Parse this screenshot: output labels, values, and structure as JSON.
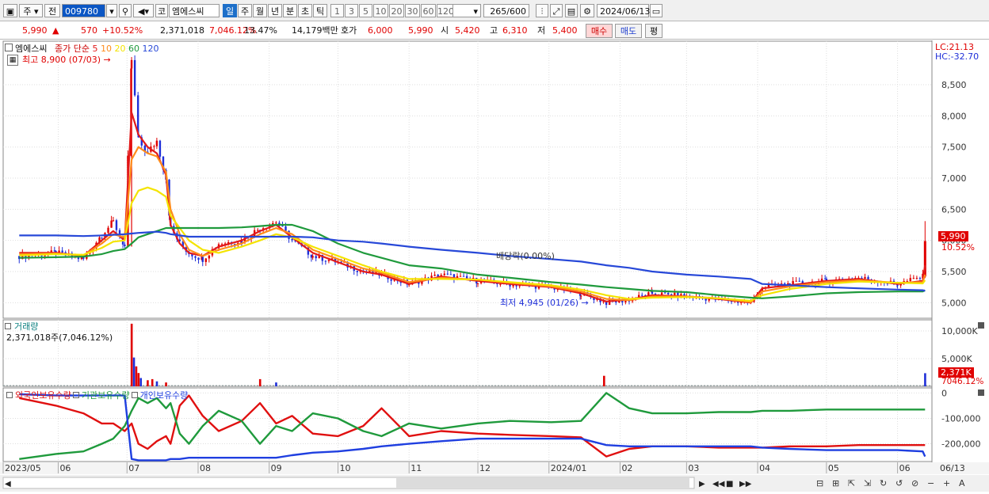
{
  "toolbar": {
    "market": "주",
    "code_type": "전",
    "code": "009780",
    "name_prefix": "코",
    "name": "엠에스씨",
    "periods": [
      "일",
      "주",
      "월",
      "년",
      "분",
      "초",
      "틱"
    ],
    "intervals": [
      "1",
      "3",
      "5",
      "10",
      "20",
      "30",
      "60",
      "120"
    ],
    "count": "265",
    "count_max": "/600",
    "date": "2024/06/13"
  },
  "quote": {
    "price": "5,990",
    "direction": "▲",
    "change": "570",
    "change_pct": "+10.52%",
    "volume": "2,371,018",
    "volume_pct": "7,046.12%",
    "turnover": "13.47%",
    "amount": "14,179백만",
    "bid_label": "호가",
    "bid1": "6,000",
    "bid2": "5,990",
    "open_label": "시",
    "open": "5,420",
    "high_label": "고",
    "high": "6,310",
    "low_label": "저",
    "low": "5,400",
    "buy": "매수",
    "sell": "매도",
    "eval": "평"
  },
  "price_panel": {
    "title": "엠에스씨",
    "ma_label": "종가 단순",
    "ma_periods": [
      "5",
      "10",
      "20",
      "60",
      "120"
    ],
    "ma_colors": [
      "#e21a1a",
      "#ff8c1a",
      "#f4e400",
      "#1f9a3c",
      "#2748d8"
    ],
    "high_note": "최고 8,900 (07/03)",
    "low_note": "최저 4,945 (01/26)",
    "dividend_note": "배당락(0.00%)",
    "lc": "LC:21.13",
    "hc": "HC:-32.70",
    "last_price": "5,990",
    "last_pct": "10.52%"
  },
  "volume_panel": {
    "title": "거래량",
    "value_note": "2,371,018주(7,046.12%)",
    "last_value": "2,371K",
    "last_pct": "7046.12%"
  },
  "holding_panel": {
    "series": [
      "외국인보유수량",
      "기관보유수량",
      "개인보유수량"
    ],
    "colors": [
      "#e01010",
      "#1f9a3c",
      "#1f3fe0"
    ]
  },
  "colors": {
    "up": "#e00000",
    "down": "#1f2fd8",
    "grid": "#d8d8d8",
    "highlight": "#e00000"
  },
  "chart_data": [
    {
      "type": "candlestick",
      "title": "엠에스씨",
      "x_ticks": [
        "2023/05",
        "06",
        "07",
        "08",
        "09",
        "10",
        "11",
        "12",
        "2024/01",
        "02",
        "03",
        "04",
        "05",
        "06",
        "06/13"
      ],
      "ylim": [
        4750,
        9200
      ],
      "y_ticks": [
        5000,
        5500,
        6000,
        6500,
        7000,
        7500,
        8000,
        8500
      ],
      "points": [
        [
          "2023-05-15",
          5750
        ],
        [
          "2023-05-31",
          5800
        ],
        [
          "2023-06-12",
          5700
        ],
        [
          "2023-06-20",
          6100
        ],
        [
          "2023-06-25",
          6300
        ],
        [
          "2023-06-30",
          5900
        ],
        [
          "2023-07-03",
          8900
        ],
        [
          "2023-07-06",
          7600
        ],
        [
          "2023-07-10",
          7400
        ],
        [
          "2023-07-14",
          7600
        ],
        [
          "2023-07-18",
          7000
        ],
        [
          "2023-07-20",
          6200
        ],
        [
          "2023-07-24",
          5950
        ],
        [
          "2023-07-28",
          5800
        ],
        [
          "2023-08-03",
          5700
        ],
        [
          "2023-08-10",
          5950
        ],
        [
          "2023-08-20",
          6000
        ],
        [
          "2023-08-28",
          6200
        ],
        [
          "2023-09-04",
          6300
        ],
        [
          "2023-09-11",
          6000
        ],
        [
          "2023-09-20",
          5750
        ],
        [
          "2023-10-01",
          5650
        ],
        [
          "2023-10-12",
          5500
        ],
        [
          "2023-10-20",
          5450
        ],
        [
          "2023-11-01",
          5300
        ],
        [
          "2023-11-15",
          5450
        ],
        [
          "2023-12-01",
          5350
        ],
        [
          "2023-12-15",
          5300
        ],
        [
          "2024-01-02",
          5250
        ],
        [
          "2024-01-15",
          5150
        ],
        [
          "2024-01-26",
          5000
        ],
        [
          "2024-02-05",
          5050
        ],
        [
          "2024-02-15",
          5150
        ],
        [
          "2024-03-01",
          5100
        ],
        [
          "2024-03-15",
          5050
        ],
        [
          "2024-03-29",
          5000
        ],
        [
          "2024-04-03",
          5250
        ],
        [
          "2024-04-15",
          5300
        ],
        [
          "2024-05-01",
          5350
        ],
        [
          "2024-05-15",
          5400
        ],
        [
          "2024-06-01",
          5300
        ],
        [
          "2024-06-12",
          5420
        ],
        [
          "2024-06-13",
          5990
        ]
      ],
      "series": [
        {
          "name": "5",
          "color": "#e21a1a",
          "values": [
            5800,
            5800,
            5750,
            6000,
            6150,
            6000,
            8050,
            7700,
            7500,
            7400,
            7050,
            6250,
            5950,
            5800,
            5750,
            5900,
            6000,
            6150,
            6250,
            6050,
            5800,
            5650,
            5500,
            5450,
            5300,
            5420,
            5350,
            5300,
            5250,
            5150,
            5020,
            5050,
            5120,
            5100,
            5060,
            5000,
            5230,
            5280,
            5350,
            5380,
            5300,
            5350,
            5600
          ]
        },
        {
          "name": "10",
          "color": "#ff8c1a",
          "values": [
            5780,
            5790,
            5760,
            5950,
            6100,
            6050,
            7300,
            7500,
            7400,
            7350,
            7100,
            6500,
            6100,
            5850,
            5750,
            5850,
            5950,
            6100,
            6200,
            6100,
            5850,
            5700,
            5550,
            5480,
            5330,
            5400,
            5370,
            5320,
            5260,
            5180,
            5060,
            5040,
            5100,
            5100,
            5070,
            5010,
            5180,
            5260,
            5330,
            5360,
            5320,
            5330,
            5450
          ]
        },
        {
          "name": "20",
          "color": "#f4e400",
          "values": [
            5760,
            5780,
            5770,
            5880,
            5980,
            6000,
            6600,
            6800,
            6850,
            6800,
            6700,
            6400,
            6200,
            6000,
            5850,
            5800,
            5900,
            6000,
            6100,
            6050,
            5900,
            5750,
            5600,
            5500,
            5380,
            5380,
            5370,
            5330,
            5280,
            5210,
            5120,
            5060,
            5080,
            5090,
            5070,
            5030,
            5120,
            5220,
            5300,
            5340,
            5320,
            5310,
            5360
          ]
        },
        {
          "name": "60",
          "color": "#1f9a3c",
          "values": [
            5720,
            5730,
            5740,
            5780,
            5830,
            5860,
            5950,
            6050,
            6100,
            6150,
            6200,
            6200,
            6200,
            6200,
            6200,
            6200,
            6210,
            6230,
            6250,
            6250,
            6150,
            5950,
            5800,
            5720,
            5600,
            5550,
            5450,
            5400,
            5330,
            5290,
            5250,
            5220,
            5190,
            5170,
            5120,
            5080,
            5070,
            5100,
            5150,
            5170,
            5180,
            5180,
            5200
          ]
        },
        {
          "name": "120",
          "color": "#2748d8",
          "values": [
            6080,
            6080,
            6070,
            6080,
            6090,
            6100,
            6110,
            6120,
            6130,
            6140,
            6120,
            6100,
            6080,
            6060,
            6060,
            6060,
            6060,
            6060,
            6060,
            6060,
            6050,
            6000,
            5980,
            5950,
            5900,
            5850,
            5800,
            5750,
            5700,
            5660,
            5600,
            5560,
            5500,
            5450,
            5420,
            5380,
            5300,
            5280,
            5250,
            5230,
            5210,
            5200,
            5190
          ]
        }
      ]
    },
    {
      "type": "bar",
      "title": "거래량",
      "y_ticks": [
        "5,000K",
        "10,000K"
      ],
      "ylim": [
        0,
        12000
      ],
      "values_k": [
        [
          "2023-07-03",
          11300
        ],
        [
          "2023-07-04",
          5200
        ],
        [
          "2023-07-05",
          3600
        ],
        [
          "2023-07-06",
          2400
        ],
        [
          "2023-07-07",
          1500
        ],
        [
          "2023-07-10",
          1100
        ],
        [
          "2023-07-12",
          1300
        ],
        [
          "2023-07-14",
          900
        ],
        [
          "2023-07-18",
          700
        ],
        [
          "2023-08-28",
          1300
        ],
        [
          "2023-09-04",
          700
        ],
        [
          "2023-01-25",
          0
        ],
        [
          "2024-01-25",
          1900
        ],
        [
          "2024-06-13",
          2371
        ]
      ]
    },
    {
      "type": "line",
      "title": "보유수량",
      "y_ticks": [
        "0",
        "-100,000",
        "-200,000"
      ],
      "ylim": [
        -270000,
        20000
      ],
      "series": [
        {
          "name": "외국인보유수량",
          "color": "#e01010",
          "values": [
            -20000,
            -50000,
            -80000,
            -120000,
            -120000,
            -150000,
            -120000,
            -200000,
            -220000,
            -190000,
            -170000,
            -200000,
            -50000,
            -10000,
            -90000,
            -150000,
            -110000,
            -40000,
            -120000,
            -90000,
            -160000,
            -170000,
            -130000,
            -60000,
            -170000,
            -150000,
            -160000,
            -165000,
            -170000,
            -175000,
            -250000,
            -220000,
            -210000,
            -210000,
            -215000,
            -215000,
            -215000,
            -210000,
            -210000,
            -205000,
            -205000,
            -205000,
            -205000
          ]
        },
        {
          "name": "기관보유수량",
          "color": "#1f9a3c",
          "values": [
            -260000,
            -240000,
            -230000,
            -200000,
            -180000,
            -130000,
            -70000,
            -20000,
            -40000,
            -20000,
            -60000,
            -40000,
            -160000,
            -200000,
            -130000,
            -70000,
            -110000,
            -200000,
            -130000,
            -150000,
            -80000,
            -100000,
            -150000,
            -170000,
            -120000,
            -140000,
            -120000,
            -110000,
            -115000,
            -110000,
            0,
            -60000,
            -80000,
            -80000,
            -75000,
            -75000,
            -70000,
            -70000,
            -65000,
            -65000,
            -65000,
            -65000,
            -65000
          ]
        },
        {
          "name": "개인보유수량",
          "color": "#1f3fe0",
          "values": [
            -5000,
            -10000,
            -10000,
            -10000,
            -10000,
            -10000,
            -260000,
            -265000,
            -265000,
            -265000,
            -265000,
            -260000,
            -260000,
            -255000,
            -255000,
            -255000,
            -255000,
            -255000,
            -255000,
            -245000,
            -235000,
            -230000,
            -220000,
            -210000,
            -200000,
            -190000,
            -180000,
            -180000,
            -180000,
            -180000,
            -205000,
            -210000,
            -210000,
            -210000,
            -210000,
            -210000,
            -215000,
            -220000,
            -225000,
            -225000,
            -225000,
            -230000,
            -250000
          ]
        }
      ]
    }
  ]
}
